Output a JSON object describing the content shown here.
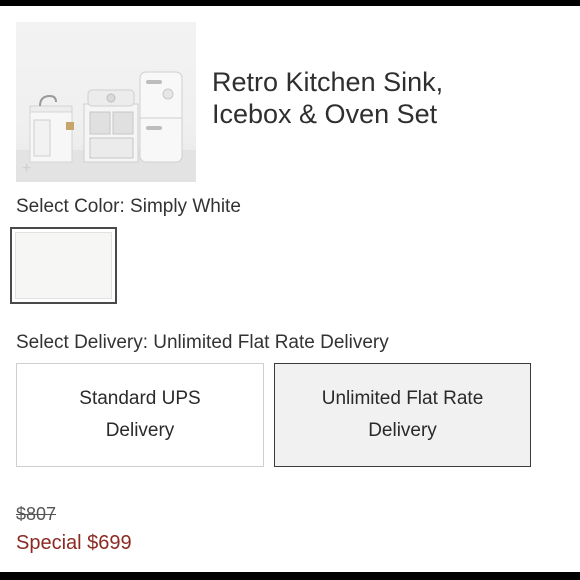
{
  "product": {
    "title_line1": "Retro Kitchen Sink,",
    "title_line2": "Icebox & Oven Set"
  },
  "color": {
    "label": "Select Color: Simply White",
    "swatch_color": "#f6f6f4"
  },
  "delivery": {
    "label": "Select Delivery: Unlimited Flat Rate Delivery",
    "options": [
      {
        "line1": "Standard UPS",
        "line2": "Delivery",
        "selected": false
      },
      {
        "line1": "Unlimited Flat Rate",
        "line2": "Delivery",
        "selected": true
      }
    ]
  },
  "price": {
    "original": "$807",
    "special": "Special $699",
    "special_color": "#8b2a22"
  },
  "icons": {
    "image_zoom": "plus-icon"
  }
}
